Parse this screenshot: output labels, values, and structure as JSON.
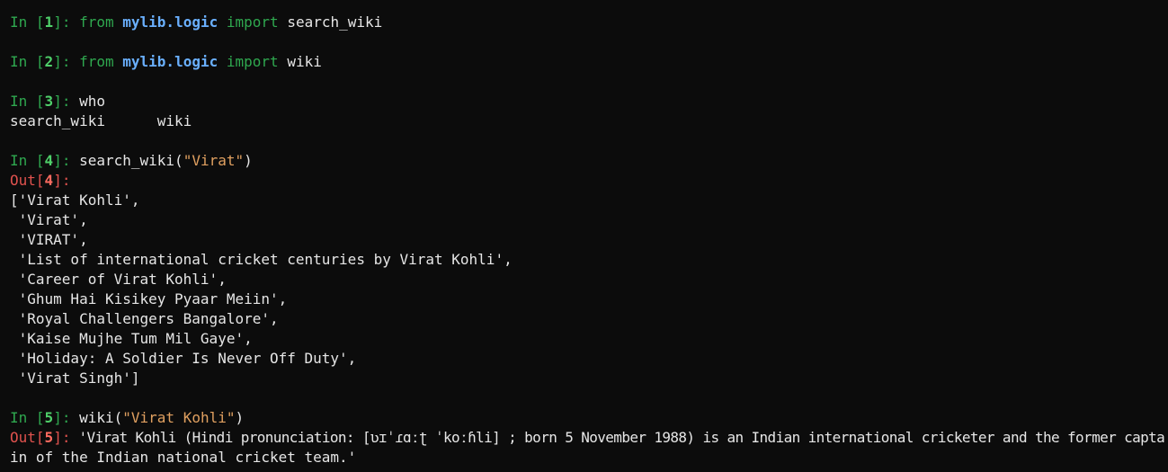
{
  "cells": {
    "c1": {
      "in_word": "In ",
      "num": "1",
      "kw_from": "from",
      "module": "mylib.logic",
      "kw_import": "import",
      "name": "search_wiki"
    },
    "c2": {
      "in_word": "In ",
      "num": "2",
      "kw_from": "from",
      "module": "mylib.logic",
      "kw_import": "import",
      "name": "wiki"
    },
    "c3": {
      "in_word": "In ",
      "num": "3",
      "code": "who",
      "output": "search_wiki\t wiki"
    },
    "c4": {
      "in_word": "In ",
      "num": "4",
      "code_pre": "search_wiki(",
      "code_str": "\"Virat\"",
      "code_post": ")",
      "out_word": "Out",
      "out_num": "4",
      "output_lines": [
        "['Virat Kohli',",
        " 'Virat',",
        " 'VIRAT',",
        " 'List of international cricket centuries by Virat Kohli',",
        " 'Career of Virat Kohli',",
        " 'Ghum Hai Kisikey Pyaar Meiin',",
        " 'Royal Challengers Bangalore',",
        " 'Kaise Mujhe Tum Mil Gaye',",
        " 'Holiday: A Soldier Is Never Off Duty',",
        " 'Virat Singh']"
      ]
    },
    "c5": {
      "in_word": "In ",
      "num": "5",
      "code_pre": "wiki(",
      "code_str": "\"Virat Kohli\"",
      "code_post": ")",
      "out_word": "Out",
      "out_num": "5",
      "output_line1": " 'Virat Kohli (Hindi pronunciation: [ʋɪˈɾɑːʈ ˈkoːɦli] ; born 5 November 1988) is an Indian international cricketer and the former capta",
      "output_line2": "in of the Indian national cricket team.'"
    }
  },
  "punct": {
    "open_bracket": "[",
    "close_bracket_colon": "]: ",
    "close_bracket_colon_nospace": "]:"
  }
}
